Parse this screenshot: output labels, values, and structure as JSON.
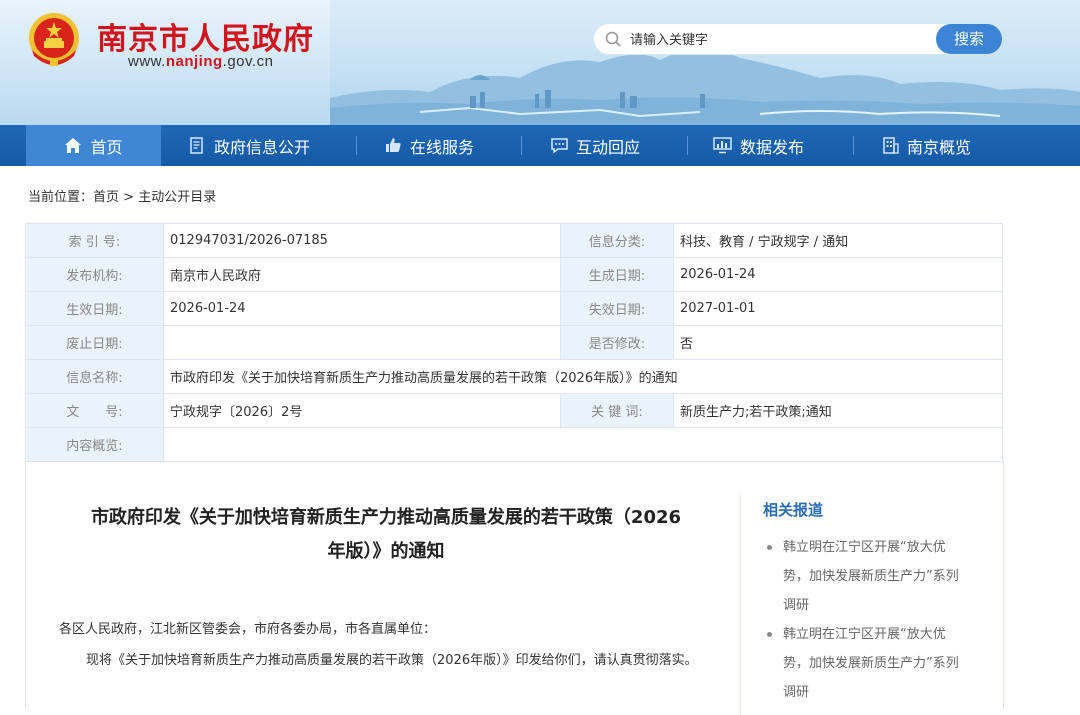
{
  "header": {
    "site_title": "南京市人民政府",
    "site_url_prefix": "www.",
    "site_url_highlight": "nanjing",
    "site_url_suffix": ".gov.cn",
    "emblem_icon": "national-emblem-icon"
  },
  "search": {
    "placeholder": "请输入关键字",
    "button_label": "搜索"
  },
  "nav": {
    "items": [
      {
        "label": "首页",
        "icon": "home-icon",
        "active": true
      },
      {
        "label": "政府信息公开",
        "icon": "document-icon"
      },
      {
        "label": "在线服务",
        "icon": "thumbs-up-icon"
      },
      {
        "label": "互动回应",
        "icon": "chat-icon"
      },
      {
        "label": "数据发布",
        "icon": "monitor-chart-icon"
      },
      {
        "label": "南京概览",
        "icon": "building-icon"
      }
    ]
  },
  "breadcrumb": {
    "prefix": "当前位置：",
    "home": "首页",
    "separator": ">",
    "current": "主动公开目录"
  },
  "info": {
    "index_label": "索 引 号:",
    "index_value": "012947031/2026-07185",
    "category_label": "信息分类:",
    "category_value": "科技、教育 / 宁政规字 / 通知",
    "publisher_label": "发布机构:",
    "publisher_value": "南京市人民政府",
    "generated_label": "生成日期:",
    "generated_value": "2026-01-24",
    "effective_label": "生效日期:",
    "effective_value": "2026-01-24",
    "expiry_label": "失效日期:",
    "expiry_value": "2027-01-01",
    "abolish_label": "废止日期:",
    "abolish_value": "",
    "modified_label": "是否修改:",
    "modified_value": "否",
    "name_label": "信息名称:",
    "name_value": "市政府印发《关于加快培育新质生产力推动高质量发展的若干政策（2026年版）》的通知",
    "docno_label": "文　　号:",
    "docno_value": "宁政规字〔2026〕2号",
    "keywords_label": "关 键 词:",
    "keywords_value": "新质生产力;若干政策;通知",
    "summary_label": "内容概览:",
    "summary_value": ""
  },
  "document": {
    "title_line1": "市政府印发《关于加快培育新质生产力推动高质量发展的若干政策（2026",
    "title_line2": "年版）》的通知",
    "addressee": "各区人民政府，江北新区管委会，市府各委办局，市各直属单位：",
    "body": "现将《关于加快培育新质生产力推动高质量发展的若干政策（2026年版）》印发给你们，请认真贯彻落实。"
  },
  "related": {
    "title": "相关报道",
    "items": [
      {
        "line1": "韩立明在江宁区开展“放大优",
        "line2": "势，加快发展新质生产力”系列",
        "line3": "调研"
      },
      {
        "line1": "韩立明在江宁区开展“放大优",
        "line2": "势，加快发展新质生产力”系列",
        "line3": "调研"
      }
    ]
  },
  "colors": {
    "brand_red": "#d2141c",
    "nav_blue": "#1a5fae",
    "nav_active": "#3f86d4",
    "search_button": "#3c84d6",
    "label_bg": "#eaf3fb",
    "link_blue": "#2b6cb4"
  }
}
